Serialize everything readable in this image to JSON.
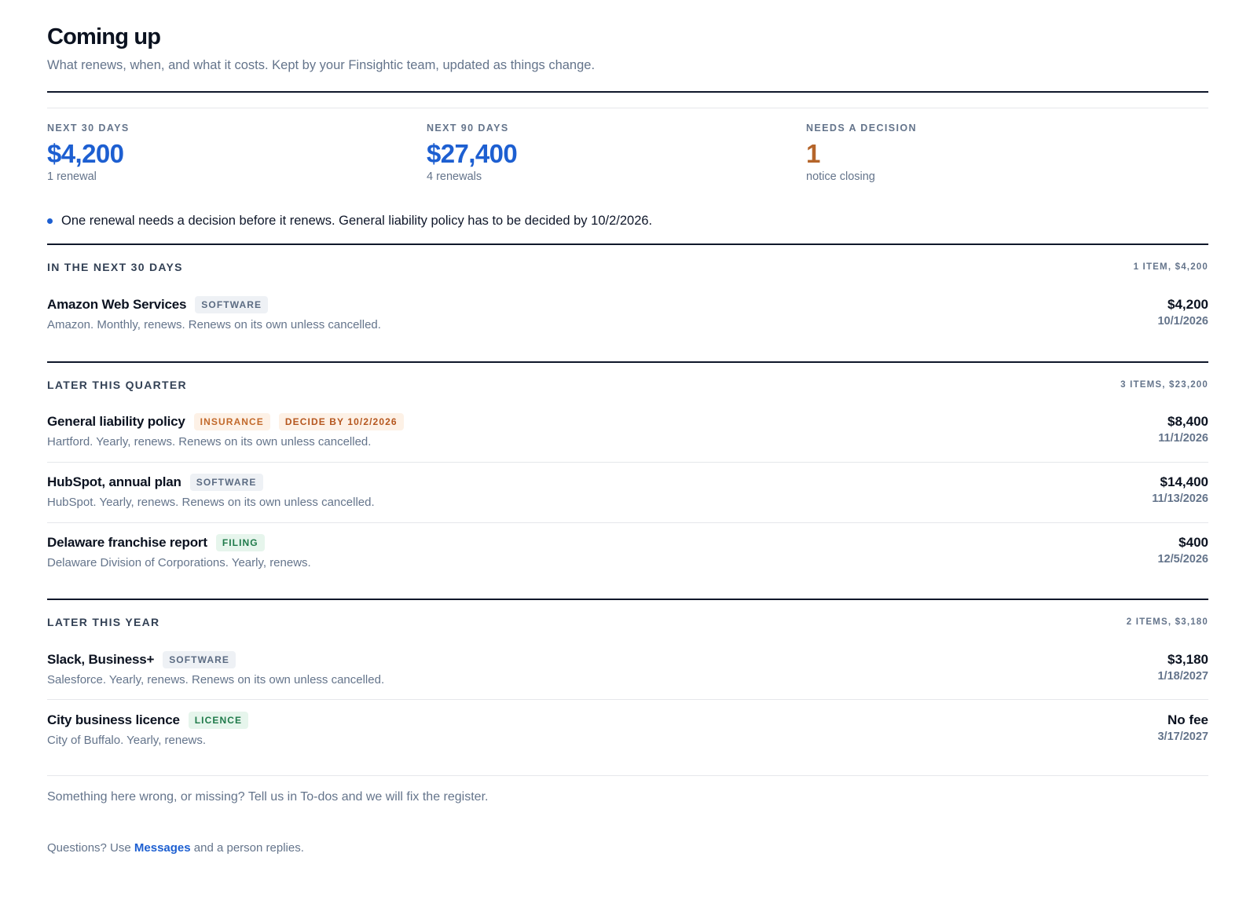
{
  "header": {
    "title": "Coming up",
    "subtitle": "What renews, when, and what it costs. Kept by your Finsightic team, updated as things change."
  },
  "stats": [
    {
      "label": "Next 30 days",
      "value": "$4,200",
      "sub": "1 renewal",
      "color": "#1d5fd1"
    },
    {
      "label": "Next 90 days",
      "value": "$27,400",
      "sub": "4 renewals",
      "color": "#1d5fd1"
    },
    {
      "label": "Needs a decision",
      "value": "1",
      "sub": "notice closing",
      "color": "#b5652a"
    }
  ],
  "notice": {
    "text": "One renewal needs a decision before it renews. General liability policy has to be decided by 10/2/2026."
  },
  "sections": [
    {
      "title": "In the next 30 days",
      "meta": "1 item, $4,200",
      "rows": [
        {
          "name": "Amazon Web Services",
          "tags": [
            {
              "label": "Software",
              "kind": "software"
            }
          ],
          "desc": "Amazon. Monthly, renews. Renews on its own unless cancelled.",
          "amount": "$4,200",
          "date": "10/1/2026"
        }
      ]
    },
    {
      "title": "Later this quarter",
      "meta": "3 items, $23,200",
      "rows": [
        {
          "name": "General liability policy",
          "tags": [
            {
              "label": "Insurance",
              "kind": "insurance"
            },
            {
              "label": "Decide by 10/2/2026",
              "kind": "decide"
            }
          ],
          "desc": "Hartford. Yearly, renews. Renews on its own unless cancelled.",
          "amount": "$8,400",
          "date": "11/1/2026"
        },
        {
          "name": "HubSpot, annual plan",
          "tags": [
            {
              "label": "Software",
              "kind": "software"
            }
          ],
          "desc": "HubSpot. Yearly, renews. Renews on its own unless cancelled.",
          "amount": "$14,400",
          "date": "11/13/2026"
        },
        {
          "name": "Delaware franchise report",
          "tags": [
            {
              "label": "Filing",
              "kind": "filing"
            }
          ],
          "desc": "Delaware Division of Corporations. Yearly, renews.",
          "amount": "$400",
          "date": "12/5/2026"
        }
      ]
    },
    {
      "title": "Later this year",
      "meta": "2 items, $3,180",
      "rows": [
        {
          "name": "Slack, Business+",
          "tags": [
            {
              "label": "Software",
              "kind": "software"
            }
          ],
          "desc": "Salesforce. Yearly, renews. Renews on its own unless cancelled.",
          "amount": "$3,180",
          "date": "1/18/2027"
        },
        {
          "name": "City business licence",
          "tags": [
            {
              "label": "Licence",
              "kind": "licence"
            }
          ],
          "desc": "City of Buffalo. Yearly, renews.",
          "amount": "No fee",
          "date": "3/17/2027"
        }
      ]
    }
  ],
  "footer": {
    "note": "Something here wrong, or missing? Tell us in To-dos and we will fix the register.",
    "questions_prefix": "Questions? Use ",
    "questions_link": "Messages",
    "questions_suffix": " and a person replies."
  }
}
